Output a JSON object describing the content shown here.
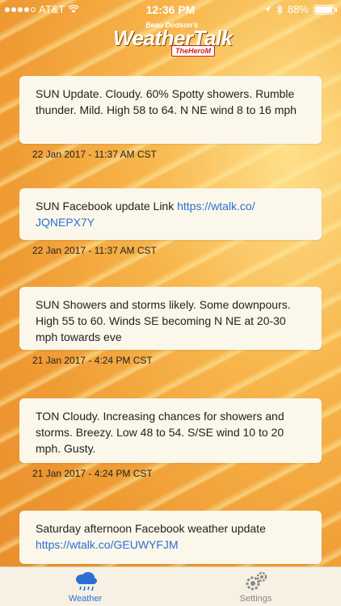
{
  "status_bar": {
    "carrier": "AT&T",
    "time": "12:36 PM",
    "battery": "88%"
  },
  "logo": {
    "byline": "Beau Dodson's",
    "title": "WeatherTalk",
    "powered": "TheHeroM"
  },
  "posts": [
    {
      "text": "SUN Update. Cloudy. 60% Spotty showers. Rumble thunder. Mild. High 58 to 64. N NE wind 8 to 16 mph",
      "link": "",
      "timestamp": "22 Jan 2017 - 11:37 AM CST"
    },
    {
      "text": "SUN Facebook update Link ",
      "link": "https://wtalk.co/\nJQNEPX7Y",
      "timestamp": "22 Jan 2017 - 11:37 AM CST"
    },
    {
      "text": "SUN Showers and storms likely. Some downpours. High 55 to 60. Winds SE becoming N NE at 20-30 mph towards eve",
      "link": "",
      "timestamp": "21 Jan 2017 - 4:24 PM CST"
    },
    {
      "text": "TON Cloudy. Increasing chances for showers and storms. Breezy. Low 48 to 54. S/SE wind 10 to 20 mph. Gusty.",
      "link": "",
      "timestamp": "21 Jan 2017 - 4:24 PM CST"
    },
    {
      "text": "Saturday afternoon Facebook weather update",
      "link": "https://wtalk.co/GEUWYFJM",
      "timestamp": ""
    }
  ],
  "tabs": [
    {
      "label": "Weather",
      "icon": "cloud-rain-icon",
      "active": true
    },
    {
      "label": "Settings",
      "icon": "gears-icon",
      "active": false
    }
  ],
  "colors": {
    "accent": "#2a6fd6",
    "card": "#fbf7ea",
    "background": "#f2a43c"
  }
}
